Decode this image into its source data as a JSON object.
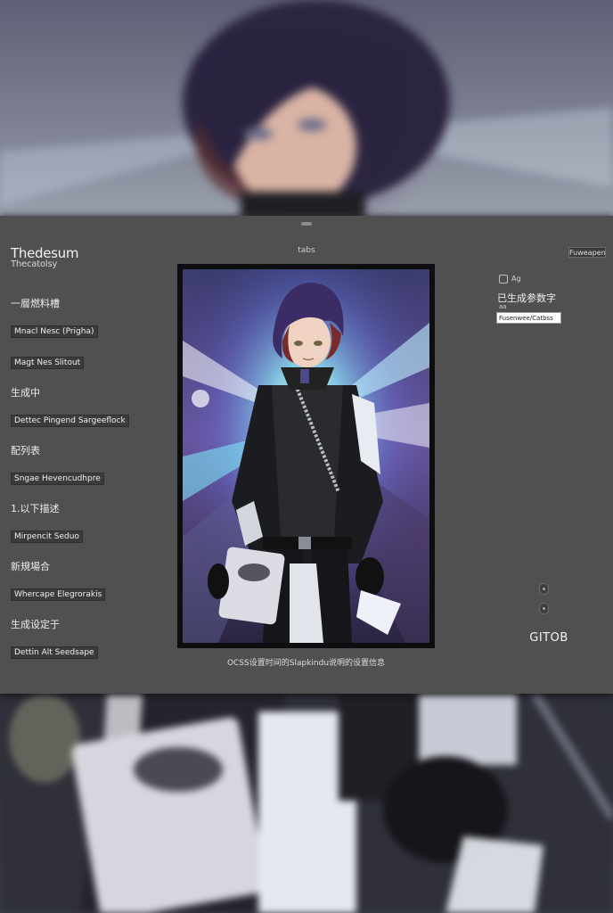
{
  "header": {
    "title": "Thedesum",
    "subtitle": "Thecatolsy",
    "center_label": "tabs",
    "top_right_button": "Fuweapen"
  },
  "fields": [
    {
      "label": "一層燃料槽",
      "value": "Mnacl Nesc (Prigha)"
    },
    {
      "label": "",
      "value": "Magt Nes Slitout"
    },
    {
      "label": "生成中",
      "value": "Dettec Pingend Sargeeflock"
    },
    {
      "label": "配列表",
      "value": "Sngae Hevencudhpre"
    },
    {
      "label": "1.以下描述",
      "value": "Mirpencit Seduo"
    },
    {
      "label": "新規場合",
      "value": "Whercape Elegrorakis"
    },
    {
      "label": "生成设定于",
      "value": "Dettin Alt Seedsape"
    }
  ],
  "image": {
    "alt": "anime character with dark purple hair in a black jacket against a burst of light",
    "caption": "OCSS设置时间的Slapkindu说明的设置信息"
  },
  "right_panel": {
    "small_text": "Ag",
    "label": "已生成参数字",
    "tiny_text": "aa",
    "input_value": "Fusenwee/Catbss",
    "action": "GITOB"
  },
  "colors": {
    "panel": "#505050",
    "field_bg": "#3b3b3b",
    "accent_cyan": "#5fd6ea",
    "accent_purple": "#7a4fbf"
  },
  "icons": {
    "top_right_dot_1": "toggle-icon",
    "top_right_dot_2": "toggle-icon"
  }
}
